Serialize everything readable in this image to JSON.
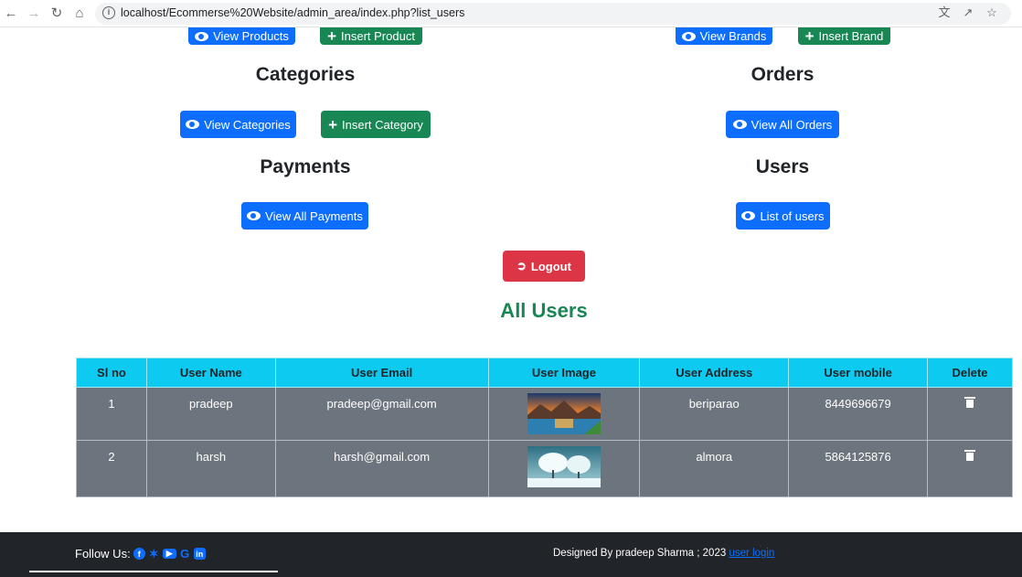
{
  "browser": {
    "url": "localhost/Ecommerse%20Website/admin_area/index.php?list_users"
  },
  "admin": {
    "products": {
      "view_label": "View Products",
      "insert_label": "Insert Product"
    },
    "brands": {
      "view_label": "View Brands",
      "insert_label": "Insert Brand"
    },
    "categories": {
      "title": "Categories",
      "view_label": "View Categories",
      "insert_label": "Insert Category"
    },
    "orders": {
      "title": "Orders",
      "view_label": "View All Orders"
    },
    "payments": {
      "title": "Payments",
      "view_label": "View All Payments"
    },
    "users": {
      "title": "Users",
      "view_label": "List of users"
    },
    "logout_label": "Logout"
  },
  "users_section": {
    "title": "All Users",
    "columns": [
      "Sl no",
      "User Name",
      "User Email",
      "User Image",
      "User Address",
      "User mobile",
      "Delete"
    ],
    "rows": [
      {
        "sl": "1",
        "name": "pradeep",
        "email": "pradeep@gmail.com",
        "image": "sunset-lake-thumbnail",
        "address": "beriparao",
        "mobile": "8449696679"
      },
      {
        "sl": "2",
        "name": "harsh",
        "email": "harsh@gmail.com",
        "image": "snowy-trees-thumbnail",
        "address": "almora",
        "mobile": "5864125876"
      }
    ]
  },
  "footer": {
    "follow_label": "Follow Us:",
    "social_icons": [
      "facebook-icon",
      "twitter-icon",
      "youtube-icon",
      "google-icon",
      "linkedin-icon"
    ],
    "designed_text": "Designed By pradeep Sharma ; 2023",
    "link_label": "user login"
  },
  "colors": {
    "primary": "#0d6efd",
    "success": "#198754",
    "danger": "#dc3545",
    "info": "#0dcaf0",
    "row_gray": "#6c757d",
    "footer_dark": "#212529"
  }
}
